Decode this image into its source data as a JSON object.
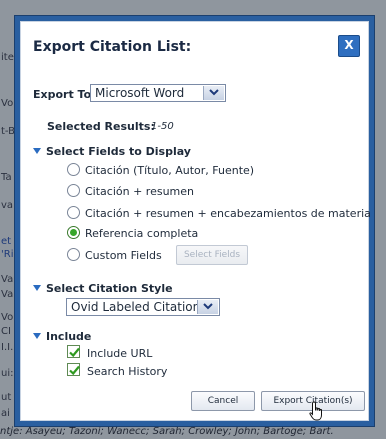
{
  "background": {
    "fragments": [
      "ites",
      "t-B",
      "Ta",
      "va",
      "et",
      "'Ri",
      "Vai",
      "Vai",
      "Vo",
      "CI",
      "I.I.",
      "ui:",
      "ut",
      "ai",
      "Vo"
    ],
    "bottom_line": "ntje: Asayeu; Tazoni; Wanecc; Sarah; Crowley; John; Bartoge; Bart."
  },
  "dialog": {
    "title": "Export Citation List:",
    "close_label": "X",
    "export_to": {
      "label": "Export To",
      "value": "Microsoft Word"
    },
    "selected_results": {
      "label": "Selected Results:",
      "value": "1-50"
    },
    "fields_section": {
      "title": "Select Fields to Display",
      "options": [
        {
          "label": "Citación (Título, Autor, Fuente)",
          "checked": false
        },
        {
          "label": "Citación + resumen",
          "checked": false
        },
        {
          "label": "Citación + resumen + encabezamientos de materia",
          "checked": false
        },
        {
          "label": "Referencia completa",
          "checked": true
        },
        {
          "label": "Custom Fields",
          "checked": false
        }
      ],
      "select_fields_button": "Select Fields"
    },
    "style_section": {
      "title": "Select Citation Style",
      "value": "Ovid Labeled Citation"
    },
    "include_section": {
      "title": "Include",
      "items": [
        {
          "label": "Include URL",
          "checked": true
        },
        {
          "label": "Search History",
          "checked": true
        }
      ]
    },
    "buttons": {
      "cancel": "Cancel",
      "export": "Export Citation(s)"
    }
  }
}
